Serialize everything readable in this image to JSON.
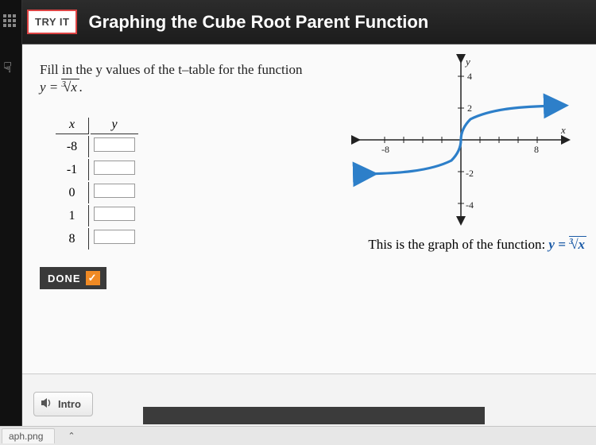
{
  "header": {
    "badge": "TRY IT",
    "title": "Graphing the Cube Root Parent Function"
  },
  "problem": {
    "prompt": "Fill in the y values of the t–table for the function",
    "equation_html": "y = ∛x.",
    "table": {
      "x_header": "x",
      "y_header": "y",
      "x_values": [
        "-8",
        "-1",
        "0",
        "1",
        "8"
      ],
      "y_values": [
        "",
        "",
        "",
        "",
        ""
      ]
    },
    "done_label": "DONE"
  },
  "graph": {
    "caption_prefix": "This is the graph of the function: ",
    "caption_fn": "y = ∛x",
    "x_ticks": [
      "-8",
      "8"
    ],
    "y_ticks": [
      "4",
      "2",
      "-2",
      "-4"
    ],
    "x_axis_label": "x",
    "y_axis_label": "y"
  },
  "chart_data": {
    "type": "line",
    "title": "y = cuberoot(x)",
    "xlabel": "x",
    "ylabel": "y",
    "xlim": [
      -10,
      10
    ],
    "ylim": [
      -5,
      5
    ],
    "x": [
      -10,
      -8,
      -6,
      -4,
      -2,
      -1,
      0,
      1,
      2,
      4,
      6,
      8,
      10
    ],
    "y": [
      -2.154,
      -2,
      -1.817,
      -1.587,
      -1.26,
      -1,
      0,
      1,
      1.26,
      1.587,
      1.817,
      2,
      2.154
    ]
  },
  "footer": {
    "intro_label": "Intro",
    "tab_filename": "aph.png"
  }
}
